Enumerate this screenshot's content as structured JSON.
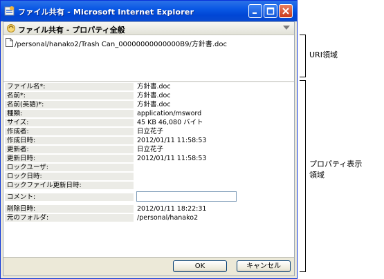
{
  "window": {
    "title": "ファイル共有 - Microsoft Internet Explorer"
  },
  "header": {
    "title": "ファイル共有 - プロパティ全般"
  },
  "uri": {
    "path": "/personal/hanako2/Trash Can_00000000000000B9/方針書.doc"
  },
  "properties": [
    {
      "label": "ファイル名*:",
      "value": "方針書.doc"
    },
    {
      "label": "名前*:",
      "value": "方針書.doc"
    },
    {
      "label": "名前(英語)*:",
      "value": "方針書.doc"
    },
    {
      "label": "種類:",
      "value": "application/msword"
    },
    {
      "label": "サイズ:",
      "value": "45 KB 46,080 バイト"
    },
    {
      "label": "作成者:",
      "value": "日立花子"
    },
    {
      "label": "作成日時:",
      "value": "2012/01/11 11:58:53"
    },
    {
      "label": "更新者:",
      "value": "日立花子"
    },
    {
      "label": "更新日時:",
      "value": "2012/01/11 11:58:53"
    },
    {
      "label": "ロックユーザ:",
      "value": ""
    },
    {
      "label": "ロック日時:",
      "value": ""
    },
    {
      "label": "ロックファイル更新日時:",
      "value": ""
    },
    {
      "label": "コメント:",
      "value": ""
    },
    {
      "label": "削除日時:",
      "value": "2012/01/11 18:22:31"
    },
    {
      "label": "元のフォルダ:",
      "value": "/personal/hanako2"
    }
  ],
  "buttons": {
    "ok": "OK",
    "cancel": "キャンセル"
  },
  "annotations": {
    "uri": "URI領域",
    "property_line1": "プロパティ表示",
    "property_line2": "領域"
  },
  "colors": {
    "titlebar": "#0a58e4",
    "label_bg": "#ebebe6",
    "window_bg": "#ece9d8"
  }
}
